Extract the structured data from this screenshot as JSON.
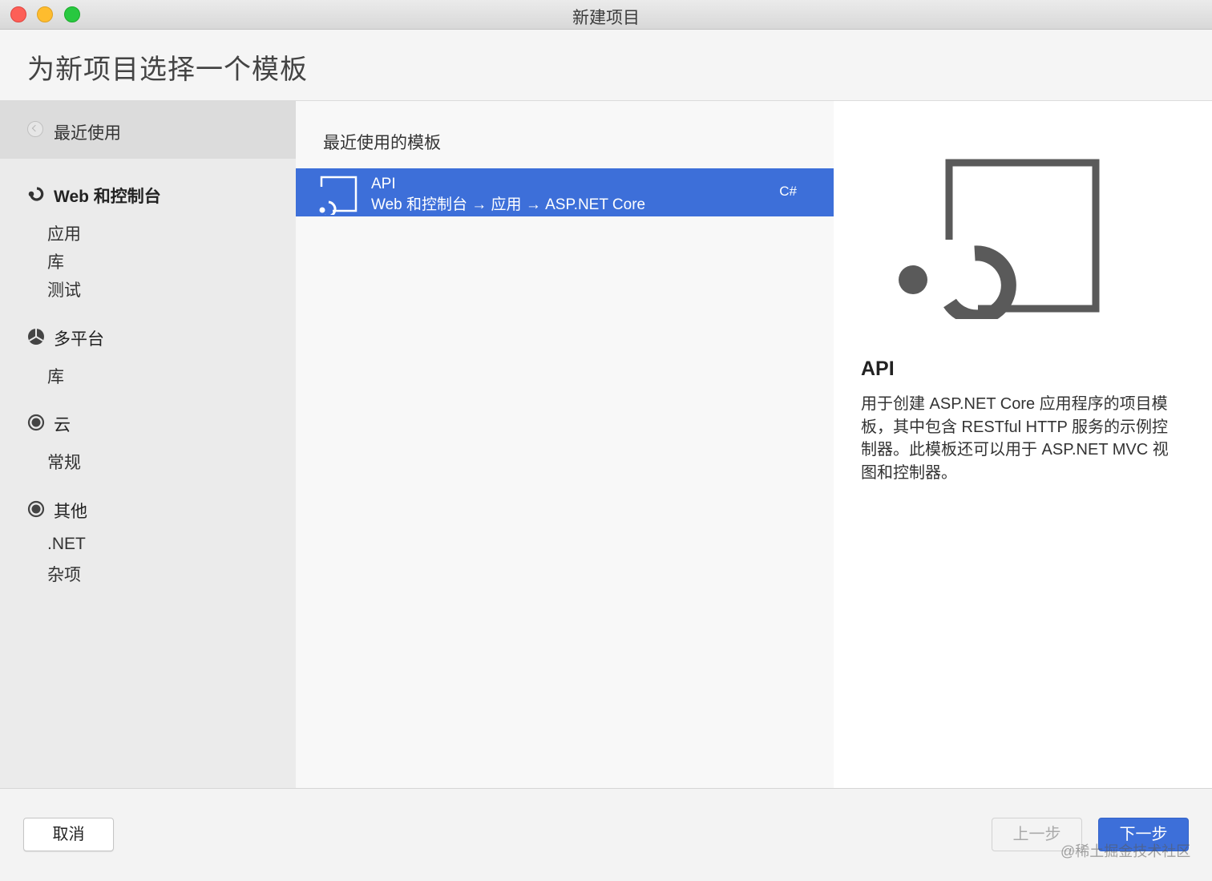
{
  "window": {
    "title": "新建项目"
  },
  "header": {
    "title": "为新项目选择一个模板"
  },
  "sidebar": {
    "recent_label": "最近使用",
    "categories": [
      {
        "label": "Web 和控制台",
        "icon": "web-console-icon",
        "items": [
          "应用",
          "库",
          "测试"
        ]
      },
      {
        "label": "多平台",
        "icon": "multiplatform-icon",
        "items": [
          "库"
        ]
      },
      {
        "label": "云",
        "icon": "cloud-icon",
        "items": [
          "常规"
        ]
      },
      {
        "label": "其他",
        "icon": "other-icon",
        "items": [
          ".NET",
          "杂项"
        ]
      }
    ]
  },
  "main": {
    "heading": "最近使用的模板",
    "templates": [
      {
        "name": "API",
        "path": "Web 和控制台 → 应用 → ASP.NET Core",
        "language": "C#",
        "selected": true
      }
    ]
  },
  "detail": {
    "title": "API",
    "description_lines": [
      "用于创建 ASP.NET Core 应用程序的项目模",
      "板，其中包含 RESTful HTTP 服务的示例控",
      "制器。此模板还可以用于 ASP.NET MVC 视",
      "图和控制器。"
    ]
  },
  "footer": {
    "cancel_label": "取消",
    "prev_label": "上一步",
    "next_label": "下一步",
    "watermark": "@稀土掘金技术社区"
  },
  "colors": {
    "accent": "#3d6fd9",
    "sidebar_bg": "#ebebeb",
    "selected_recent_bg": "#dcdcdc"
  }
}
